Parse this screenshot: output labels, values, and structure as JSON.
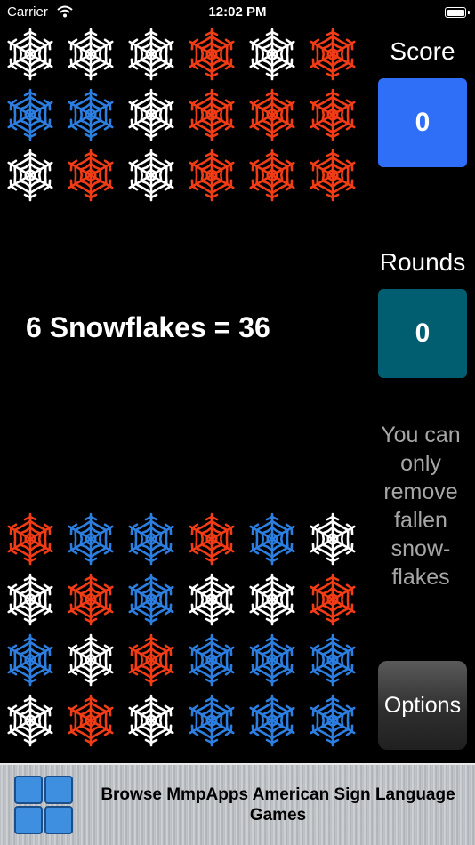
{
  "status_bar": {
    "carrier": "Carrier",
    "time": "12:02 PM"
  },
  "colors": {
    "red": "#f23c16",
    "blue": "#2c7fe0",
    "white": "#ffffff",
    "score_box": "#2f6ef7",
    "rounds_box": "#005e70"
  },
  "board_top": [
    [
      "white",
      "white",
      "white",
      "red",
      "white",
      "red"
    ],
    [
      "blue",
      "blue",
      "white",
      "red",
      "red",
      "red"
    ],
    [
      "white",
      "red",
      "white",
      "red",
      "red",
      "red"
    ]
  ],
  "board_bottom": [
    [
      "red",
      "blue",
      "blue",
      "red",
      "blue",
      "white"
    ],
    [
      "white",
      "red",
      "blue",
      "white",
      "white",
      "red"
    ],
    [
      "blue",
      "white",
      "red",
      "blue",
      "blue",
      "blue"
    ],
    [
      "white",
      "red",
      "white",
      "blue",
      "blue",
      "blue"
    ]
  ],
  "equation": "6 Snowflakes = 36",
  "score": {
    "label": "Score",
    "value": "0"
  },
  "rounds": {
    "label": "Rounds",
    "value": "0"
  },
  "hint_lines": [
    "You can",
    "only",
    "remove",
    "fallen",
    "snow-",
    "flakes"
  ],
  "options_label": "Options",
  "ad": {
    "text": "Browse MmpApps American Sign Language Games"
  }
}
